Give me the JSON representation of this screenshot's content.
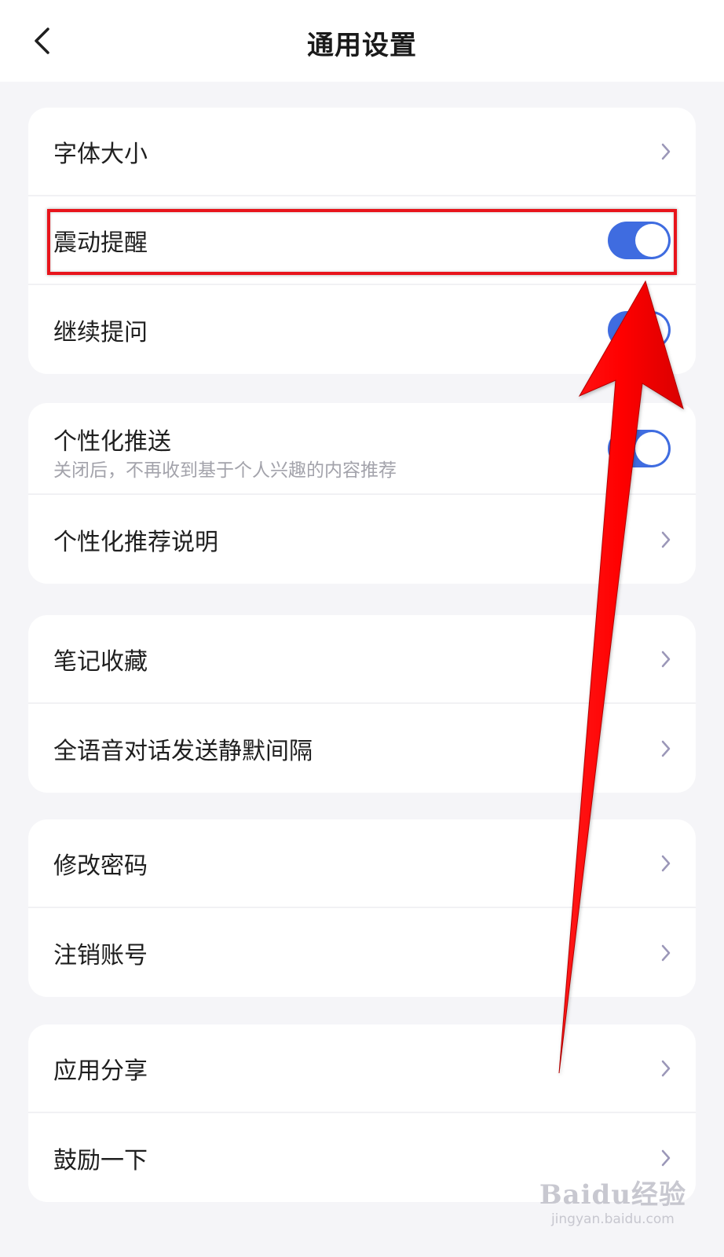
{
  "header": {
    "title": "通用设置",
    "back_icon": "chevron-left-icon"
  },
  "groups": [
    {
      "items": [
        {
          "label": "字体大小",
          "control": "chevron"
        },
        {
          "label": "震动提醒",
          "control": "toggle",
          "on": true
        },
        {
          "label": "继续提问",
          "control": "toggle",
          "on": true
        }
      ]
    },
    {
      "items": [
        {
          "label": "个性化推送",
          "desc": "关闭后，不再收到基于个人兴趣的内容推荐",
          "control": "toggle",
          "on": true
        },
        {
          "label": "个性化推荐说明",
          "control": "chevron"
        }
      ]
    },
    {
      "items": [
        {
          "label": "笔记收藏",
          "control": "chevron"
        },
        {
          "label": "全语音对话发送静默间隔",
          "control": "chevron"
        }
      ]
    },
    {
      "items": [
        {
          "label": "修改密码",
          "control": "chevron"
        },
        {
          "label": "注销账号",
          "control": "chevron"
        }
      ]
    },
    {
      "items": [
        {
          "label": "应用分享",
          "control": "chevron"
        },
        {
          "label": "鼓励一下",
          "control": "chevron"
        }
      ]
    }
  ],
  "watermark": {
    "logo": "Baidu经验",
    "url": "jingyan.baidu.com"
  },
  "colors": {
    "accent": "#3f6ce0",
    "annotation": "#e8141b",
    "background": "#f5f5f8"
  }
}
